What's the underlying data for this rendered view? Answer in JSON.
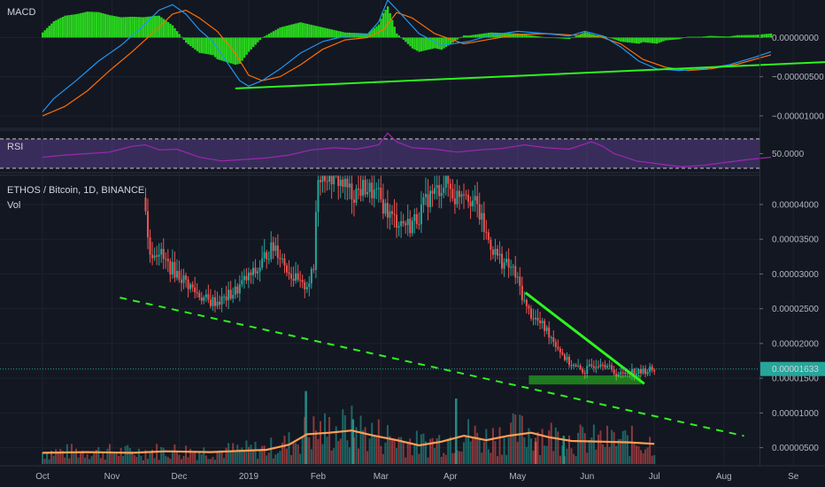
{
  "symbol": {
    "title": "ETHOS / Bitcoin, 1D, BINANCE",
    "volume_label": "Vol"
  },
  "indicators": {
    "macd_label": "MACD",
    "rsi_label": "RSI"
  },
  "colors": {
    "background": "#131722",
    "grid": "#1e222d",
    "up": "#26a69a",
    "down": "#ef5350",
    "trendline": "#2ef31f",
    "macd_line": "#2196f3",
    "signal_line": "#ff6d00",
    "histogram": "#2ef31f",
    "rsi_line": "#9c27b0",
    "rsi_band": "#7e57c2",
    "volume_ma": "#ff9f54",
    "price_tag": "#26a69a"
  },
  "chart_data": [
    {
      "type": "line",
      "title": "MACD",
      "y_ticks": [
        "0.00000000",
        "−0.00000500",
        "−0.00001000"
      ],
      "y_tick_values": [
        0,
        -5e-06,
        -1e-05
      ],
      "ylim": [
        -1.16e-05,
        4.8e-06
      ],
      "series": [
        {
          "name": "MACD",
          "points": [
            [
              0,
              -9.5e-06
            ],
            [
              5,
              -7.8e-06
            ],
            [
              15,
              -5.5e-06
            ],
            [
              25,
              -3e-06
            ],
            [
              35,
              -1e-06
            ],
            [
              45,
              1.5e-06
            ],
            [
              52,
              3.5e-06
            ],
            [
              58,
              4.2e-06
            ],
            [
              64,
              3e-06
            ],
            [
              70,
              1e-06
            ],
            [
              76,
              -5e-07
            ],
            [
              82,
              -3e-06
            ],
            [
              88,
              -5.5e-06
            ],
            [
              92,
              -6.2e-06
            ],
            [
              98,
              -5.5e-06
            ],
            [
              106,
              -4e-06
            ],
            [
              115,
              -2e-06
            ],
            [
              125,
              -5e-07
            ],
            [
              135,
              2e-07
            ],
            [
              145,
              4e-07
            ],
            [
              150,
              2e-06
            ],
            [
              154,
              4.8e-06
            ],
            [
              160,
              3e-06
            ],
            [
              168,
              5e-07
            ],
            [
              178,
              -1e-06
            ],
            [
              190,
              -5e-07
            ],
            [
              200,
              3e-07
            ],
            [
              212,
              8e-07
            ],
            [
              225,
              5e-07
            ],
            [
              235,
              2e-07
            ],
            [
              242,
              8e-07
            ],
            [
              250,
              2e-07
            ],
            [
              258,
              -1.2e-06
            ],
            [
              266,
              -3e-06
            ],
            [
              274,
              -4e-06
            ],
            [
              284,
              -4.2e-06
            ],
            [
              294,
              -4e-06
            ],
            [
              306,
              -3.5e-06
            ],
            [
              318,
              -2.5e-06
            ],
            [
              325,
              -1.8e-06
            ]
          ]
        },
        {
          "name": "Signal",
          "points": [
            [
              0,
              -1e-05
            ],
            [
              10,
              -8.8e-06
            ],
            [
              20,
              -6.8e-06
            ],
            [
              30,
              -4.2e-06
            ],
            [
              40,
              -1.8e-06
            ],
            [
              50,
              8e-07
            ],
            [
              58,
              3e-06
            ],
            [
              64,
              3.5e-06
            ],
            [
              70,
              2.5e-06
            ],
            [
              78,
              8e-07
            ],
            [
              86,
              -2e-06
            ],
            [
              92,
              -4.8e-06
            ],
            [
              98,
              -5.5e-06
            ],
            [
              106,
              -5e-06
            ],
            [
              115,
              -3.5e-06
            ],
            [
              125,
              -1.5e-06
            ],
            [
              135,
              -3e-07
            ],
            [
              145,
              0.0
            ],
            [
              152,
              1e-06
            ],
            [
              158,
              3.2e-06
            ],
            [
              165,
              2.5e-06
            ],
            [
              175,
              5e-07
            ],
            [
              188,
              -8e-07
            ],
            [
              200,
              -2e-07
            ],
            [
              212,
              4e-07
            ],
            [
              225,
              5e-07
            ],
            [
              238,
              3e-07
            ],
            [
              248,
              2e-07
            ],
            [
              258,
              -8e-07
            ],
            [
              268,
              -2.8e-06
            ],
            [
              278,
              -3.8e-06
            ],
            [
              288,
              -4.2e-06
            ],
            [
              298,
              -4e-06
            ],
            [
              310,
              -3.4e-06
            ],
            [
              325,
              -2.2e-06
            ]
          ]
        }
      ],
      "histogram": {
        "x_range": [
          0,
          325
        ],
        "peak_positive_x": 154,
        "peak_negative_x": 92
      },
      "trendline": [
        [
          86,
          -6.5e-06
        ],
        [
          375,
          -2.8e-06
        ]
      ]
    },
    {
      "type": "line",
      "title": "RSI",
      "y_ticks": [
        "50.0000"
      ],
      "y_tick_values": [
        50
      ],
      "ylim": [
        24,
        82
      ],
      "band": [
        30,
        70
      ],
      "series": [
        {
          "name": "RSI",
          "points": [
            [
              0,
              45
            ],
            [
              10,
              48
            ],
            [
              20,
              50
            ],
            [
              30,
              52
            ],
            [
              40,
              60
            ],
            [
              46,
              62
            ],
            [
              52,
              55
            ],
            [
              60,
              56
            ],
            [
              70,
              45
            ],
            [
              80,
              40
            ],
            [
              90,
              42
            ],
            [
              100,
              44
            ],
            [
              110,
              48
            ],
            [
              120,
              55
            ],
            [
              130,
              58
            ],
            [
              140,
              56
            ],
            [
              150,
              62
            ],
            [
              154,
              78
            ],
            [
              158,
              66
            ],
            [
              165,
              58
            ],
            [
              175,
              56
            ],
            [
              185,
              52
            ],
            [
              195,
              55
            ],
            [
              205,
              57
            ],
            [
              215,
              62
            ],
            [
              225,
              58
            ],
            [
              235,
              56
            ],
            [
              245,
              66
            ],
            [
              250,
              60
            ],
            [
              255,
              50
            ],
            [
              265,
              40
            ],
            [
              275,
              36
            ],
            [
              285,
              32
            ],
            [
              295,
              34
            ],
            [
              305,
              38
            ],
            [
              315,
              42
            ],
            [
              325,
              45
            ]
          ]
        }
      ]
    },
    {
      "type": "candlestick",
      "title": "ETHOS / Bitcoin, 1D, BINANCE",
      "y_ticks": [
        "0.00004000",
        "0.00003500",
        "0.00003000",
        "0.00002500",
        "0.00002000",
        "0.00001500",
        "0.00001000",
        "0.00000500"
      ],
      "y_tick_values": [
        4e-05,
        3.5e-05,
        3e-05,
        2.5e-05,
        2e-05,
        1.5e-05,
        1e-05,
        5e-06
      ],
      "ylim": [
        2.4e-06,
        4.42e-05
      ],
      "last_price": "0.00001633",
      "last_price_value": 1.633e-05,
      "x_ticks": [
        "Oct",
        "Nov",
        "Dec",
        "2019",
        "Feb",
        "Mar",
        "Apr",
        "May",
        "Jun",
        "Jul",
        "Aug",
        "Se"
      ],
      "x_tick_days": [
        0,
        31,
        61,
        92,
        123,
        151,
        182,
        212,
        243,
        273,
        304,
        335
      ],
      "close_path": [
        [
          45.5,
          4.1e-05
        ],
        [
          46,
          3.95e-05
        ],
        [
          47,
          3.5e-05
        ],
        [
          48,
          3.3e-05
        ],
        [
          52,
          3.35e-05
        ],
        [
          54,
          3.2e-05
        ],
        [
          57,
          3.1e-05
        ],
        [
          62,
          2.95e-05
        ],
        [
          68,
          2.75e-05
        ],
        [
          74,
          2.6e-05
        ],
        [
          80,
          2.62e-05
        ],
        [
          86,
          2.75e-05
        ],
        [
          90,
          2.9e-05
        ],
        [
          96,
          3.05e-05
        ],
        [
          100,
          3.3e-05
        ],
        [
          104,
          3.4e-05
        ],
        [
          108,
          3.15e-05
        ],
        [
          112,
          2.95e-05
        ],
        [
          116,
          2.8e-05
        ],
        [
          119,
          2.9e-05
        ],
        [
          121,
          3.05e-05
        ],
        [
          122,
          3.9e-05
        ],
        [
          123,
          4.45e-05
        ],
        [
          128,
          4.45e-05
        ],
        [
          134,
          4.3e-05
        ],
        [
          138,
          4.15e-05
        ],
        [
          144,
          4.25e-05
        ],
        [
          150,
          4.1e-05
        ],
        [
          156,
          3.8e-05
        ],
        [
          160,
          3.75e-05
        ],
        [
          164,
          3.7e-05
        ],
        [
          168,
          3.85e-05
        ],
        [
          172,
          4.1e-05
        ],
        [
          176,
          4.2e-05
        ],
        [
          180,
          4.35e-05
        ],
        [
          184,
          4.1e-05
        ],
        [
          188,
          4.25e-05
        ],
        [
          192,
          4.05e-05
        ],
        [
          194,
          3.95e-05
        ],
        [
          198,
          3.55e-05
        ],
        [
          202,
          3.3e-05
        ],
        [
          206,
          3.15e-05
        ],
        [
          210,
          3.05e-05
        ],
        [
          213,
          2.8e-05
        ],
        [
          216,
          2.5e-05
        ],
        [
          220,
          2.35e-05
        ],
        [
          226,
          2.15e-05
        ],
        [
          230,
          1.95e-05
        ],
        [
          234,
          1.75e-05
        ],
        [
          238,
          1.65e-05
        ],
        [
          242,
          1.6e-05
        ],
        [
          246,
          1.7e-05
        ],
        [
          250,
          1.75e-05
        ],
        [
          254,
          1.6e-05
        ],
        [
          258,
          1.55e-05
        ],
        [
          262,
          1.6e-05
        ],
        [
          266,
          1.58e-05
        ],
        [
          270,
          1.62e-05
        ],
        [
          273,
          1.633e-05
        ]
      ],
      "trendlines": [
        {
          "style": "solid",
          "points": [
            [
              215.5,
              2.73e-05
            ],
            [
              268.5,
              1.42e-05
            ]
          ]
        },
        {
          "style": "dashed",
          "points": [
            [
              34.5,
              2.66e-05
            ],
            [
              313,
              6.7e-06
            ]
          ]
        }
      ],
      "support_zone": {
        "x": [
          217,
          267
        ],
        "y": [
          1.41e-05,
          1.54e-05
        ]
      }
    },
    {
      "type": "bar",
      "title": "Vol",
      "spikes": [
        [
          117.5,
          0.98
        ],
        [
          138.5,
          0.6
        ],
        [
          184.5,
          0.88
        ],
        [
          220,
          0.3
        ],
        [
          232.5,
          0.38
        ]
      ],
      "ma_path": [
        [
          0,
          0.15
        ],
        [
          20,
          0.16
        ],
        [
          40,
          0.15
        ],
        [
          55,
          0.17
        ],
        [
          75,
          0.16
        ],
        [
          100,
          0.19
        ],
        [
          110,
          0.26
        ],
        [
          118,
          0.4
        ],
        [
          128,
          0.42
        ],
        [
          138,
          0.45
        ],
        [
          148,
          0.38
        ],
        [
          158,
          0.32
        ],
        [
          168,
          0.25
        ],
        [
          178,
          0.3
        ],
        [
          188,
          0.38
        ],
        [
          198,
          0.32
        ],
        [
          208,
          0.38
        ],
        [
          218,
          0.42
        ],
        [
          226,
          0.36
        ],
        [
          236,
          0.31
        ],
        [
          250,
          0.3
        ],
        [
          262,
          0.29
        ],
        [
          273,
          0.27
        ]
      ]
    }
  ]
}
